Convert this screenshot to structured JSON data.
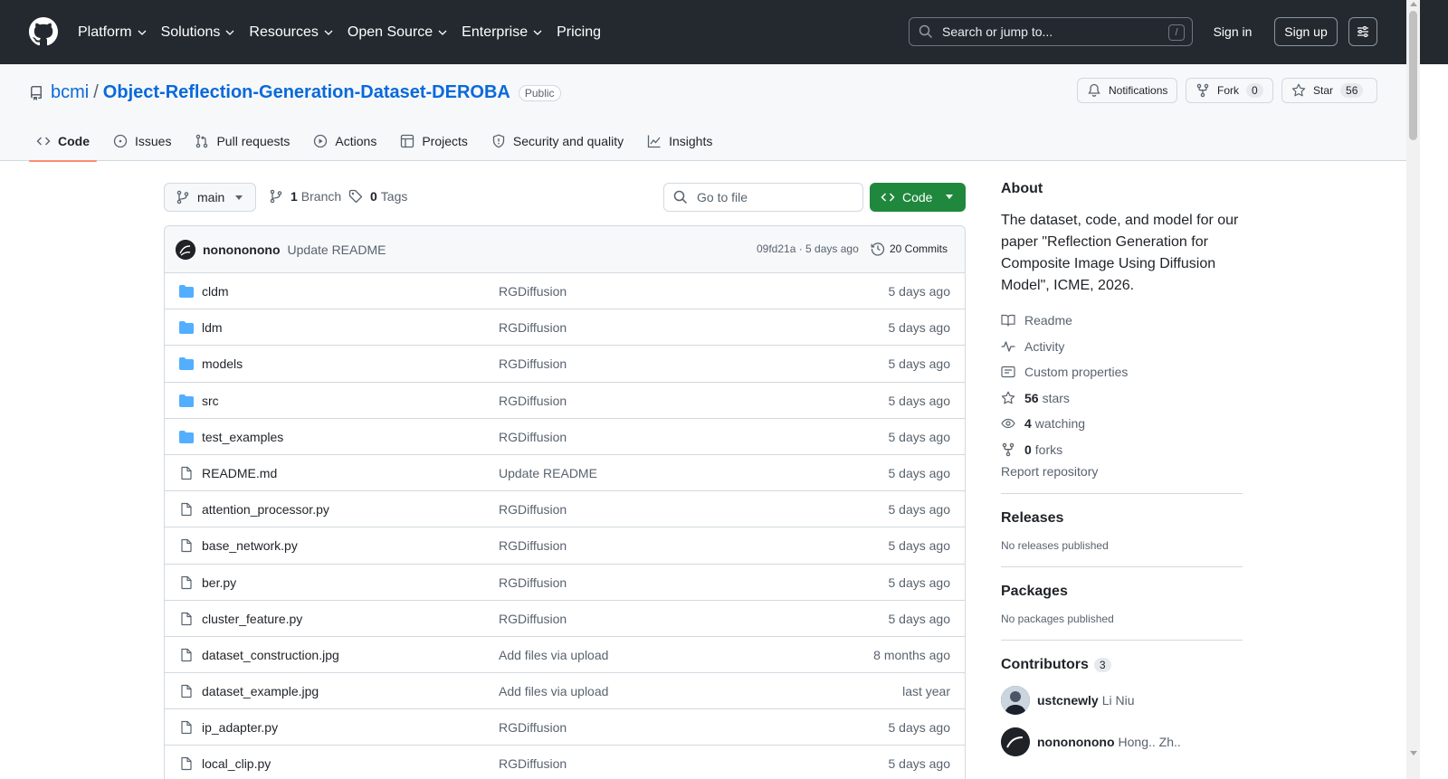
{
  "header": {
    "nav": [
      {
        "label": "Platform",
        "dropdown": true
      },
      {
        "label": "Solutions",
        "dropdown": true
      },
      {
        "label": "Resources",
        "dropdown": true
      },
      {
        "label": "Open Source",
        "dropdown": true
      },
      {
        "label": "Enterprise",
        "dropdown": true
      },
      {
        "label": "Pricing",
        "dropdown": false
      }
    ],
    "search_placeholder": "Search or jump to...",
    "search_shortcut": "/",
    "signin": "Sign in",
    "signup": "Sign up"
  },
  "repo": {
    "owner": "bcmi",
    "separator": "/",
    "name": "Object-Reflection-Generation-Dataset-DEROBA",
    "visibility": "Public",
    "notifications_label": "Notifications",
    "fork_label": "Fork",
    "fork_count": "0",
    "star_label": "Star",
    "star_count": "56"
  },
  "tabs": [
    {
      "label": "Code",
      "icon": "code-icon",
      "active": true
    },
    {
      "label": "Issues",
      "icon": "issue-icon",
      "active": false
    },
    {
      "label": "Pull requests",
      "icon": "pull-request-icon",
      "active": false
    },
    {
      "label": "Actions",
      "icon": "play-icon",
      "active": false
    },
    {
      "label": "Projects",
      "icon": "table-icon",
      "active": false
    },
    {
      "label": "Security and quality",
      "icon": "shield-icon",
      "active": false
    },
    {
      "label": "Insights",
      "icon": "graph-icon",
      "active": false
    }
  ],
  "toolbar": {
    "branch": "main",
    "branch_count": "1",
    "branch_label": "Branch",
    "tag_count": "0",
    "tag_label": "Tags",
    "goto_placeholder": "Go to file",
    "code_button": "Code"
  },
  "commit": {
    "author": "nonononono",
    "message": "Update README",
    "hash_time": "09fd21a · 5 days ago",
    "commits_label": "20 Commits"
  },
  "files": [
    {
      "name": "cldm",
      "type": "dir",
      "message": "RGDiffusion",
      "date": "5 days ago"
    },
    {
      "name": "ldm",
      "type": "dir",
      "message": "RGDiffusion",
      "date": "5 days ago"
    },
    {
      "name": "models",
      "type": "dir",
      "message": "RGDiffusion",
      "date": "5 days ago"
    },
    {
      "name": "src",
      "type": "dir",
      "message": "RGDiffusion",
      "date": "5 days ago"
    },
    {
      "name": "test_examples",
      "type": "dir",
      "message": "RGDiffusion",
      "date": "5 days ago"
    },
    {
      "name": "README.md",
      "type": "file",
      "message": "Update README",
      "date": "5 days ago"
    },
    {
      "name": "attention_processor.py",
      "type": "file",
      "message": "RGDiffusion",
      "date": "5 days ago"
    },
    {
      "name": "base_network.py",
      "type": "file",
      "message": "RGDiffusion",
      "date": "5 days ago"
    },
    {
      "name": "ber.py",
      "type": "file",
      "message": "RGDiffusion",
      "date": "5 days ago"
    },
    {
      "name": "cluster_feature.py",
      "type": "file",
      "message": "RGDiffusion",
      "date": "5 days ago"
    },
    {
      "name": "dataset_construction.jpg",
      "type": "file",
      "message": "Add files via upload",
      "date": "8 months ago"
    },
    {
      "name": "dataset_example.jpg",
      "type": "file",
      "message": "Add files via upload",
      "date": "last year"
    },
    {
      "name": "ip_adapter.py",
      "type": "file",
      "message": "RGDiffusion",
      "date": "5 days ago"
    },
    {
      "name": "local_clip.py",
      "type": "file",
      "message": "RGDiffusion",
      "date": "5 days ago"
    }
  ],
  "about": {
    "title": "About",
    "description": "The dataset, code, and model for our paper \"Reflection Generation for Composite Image Using Diffusion Model\", ICME, 2026.",
    "readme": "Readme",
    "activity": "Activity",
    "custom_properties": "Custom properties",
    "stars_count": "56",
    "stars_label": "stars",
    "watching_count": "4",
    "watching_label": "watching",
    "forks_count": "0",
    "forks_label": "forks",
    "report": "Report repository"
  },
  "releases": {
    "title": "Releases",
    "empty": "No releases published"
  },
  "packages": {
    "title": "Packages",
    "empty": "No packages published"
  },
  "contributors": {
    "title": "Contributors",
    "count": "3",
    "list": [
      {
        "login": "ustcnewly",
        "name": "Li Niu"
      },
      {
        "login": "nonononono",
        "name": "Hong.. Zh.."
      }
    ]
  },
  "colors": {
    "accent": "#0969da",
    "code_button": "#1f883d",
    "header_bg": "#24292f",
    "folder": "#54aeff",
    "active_tab": "#fd8c73"
  }
}
